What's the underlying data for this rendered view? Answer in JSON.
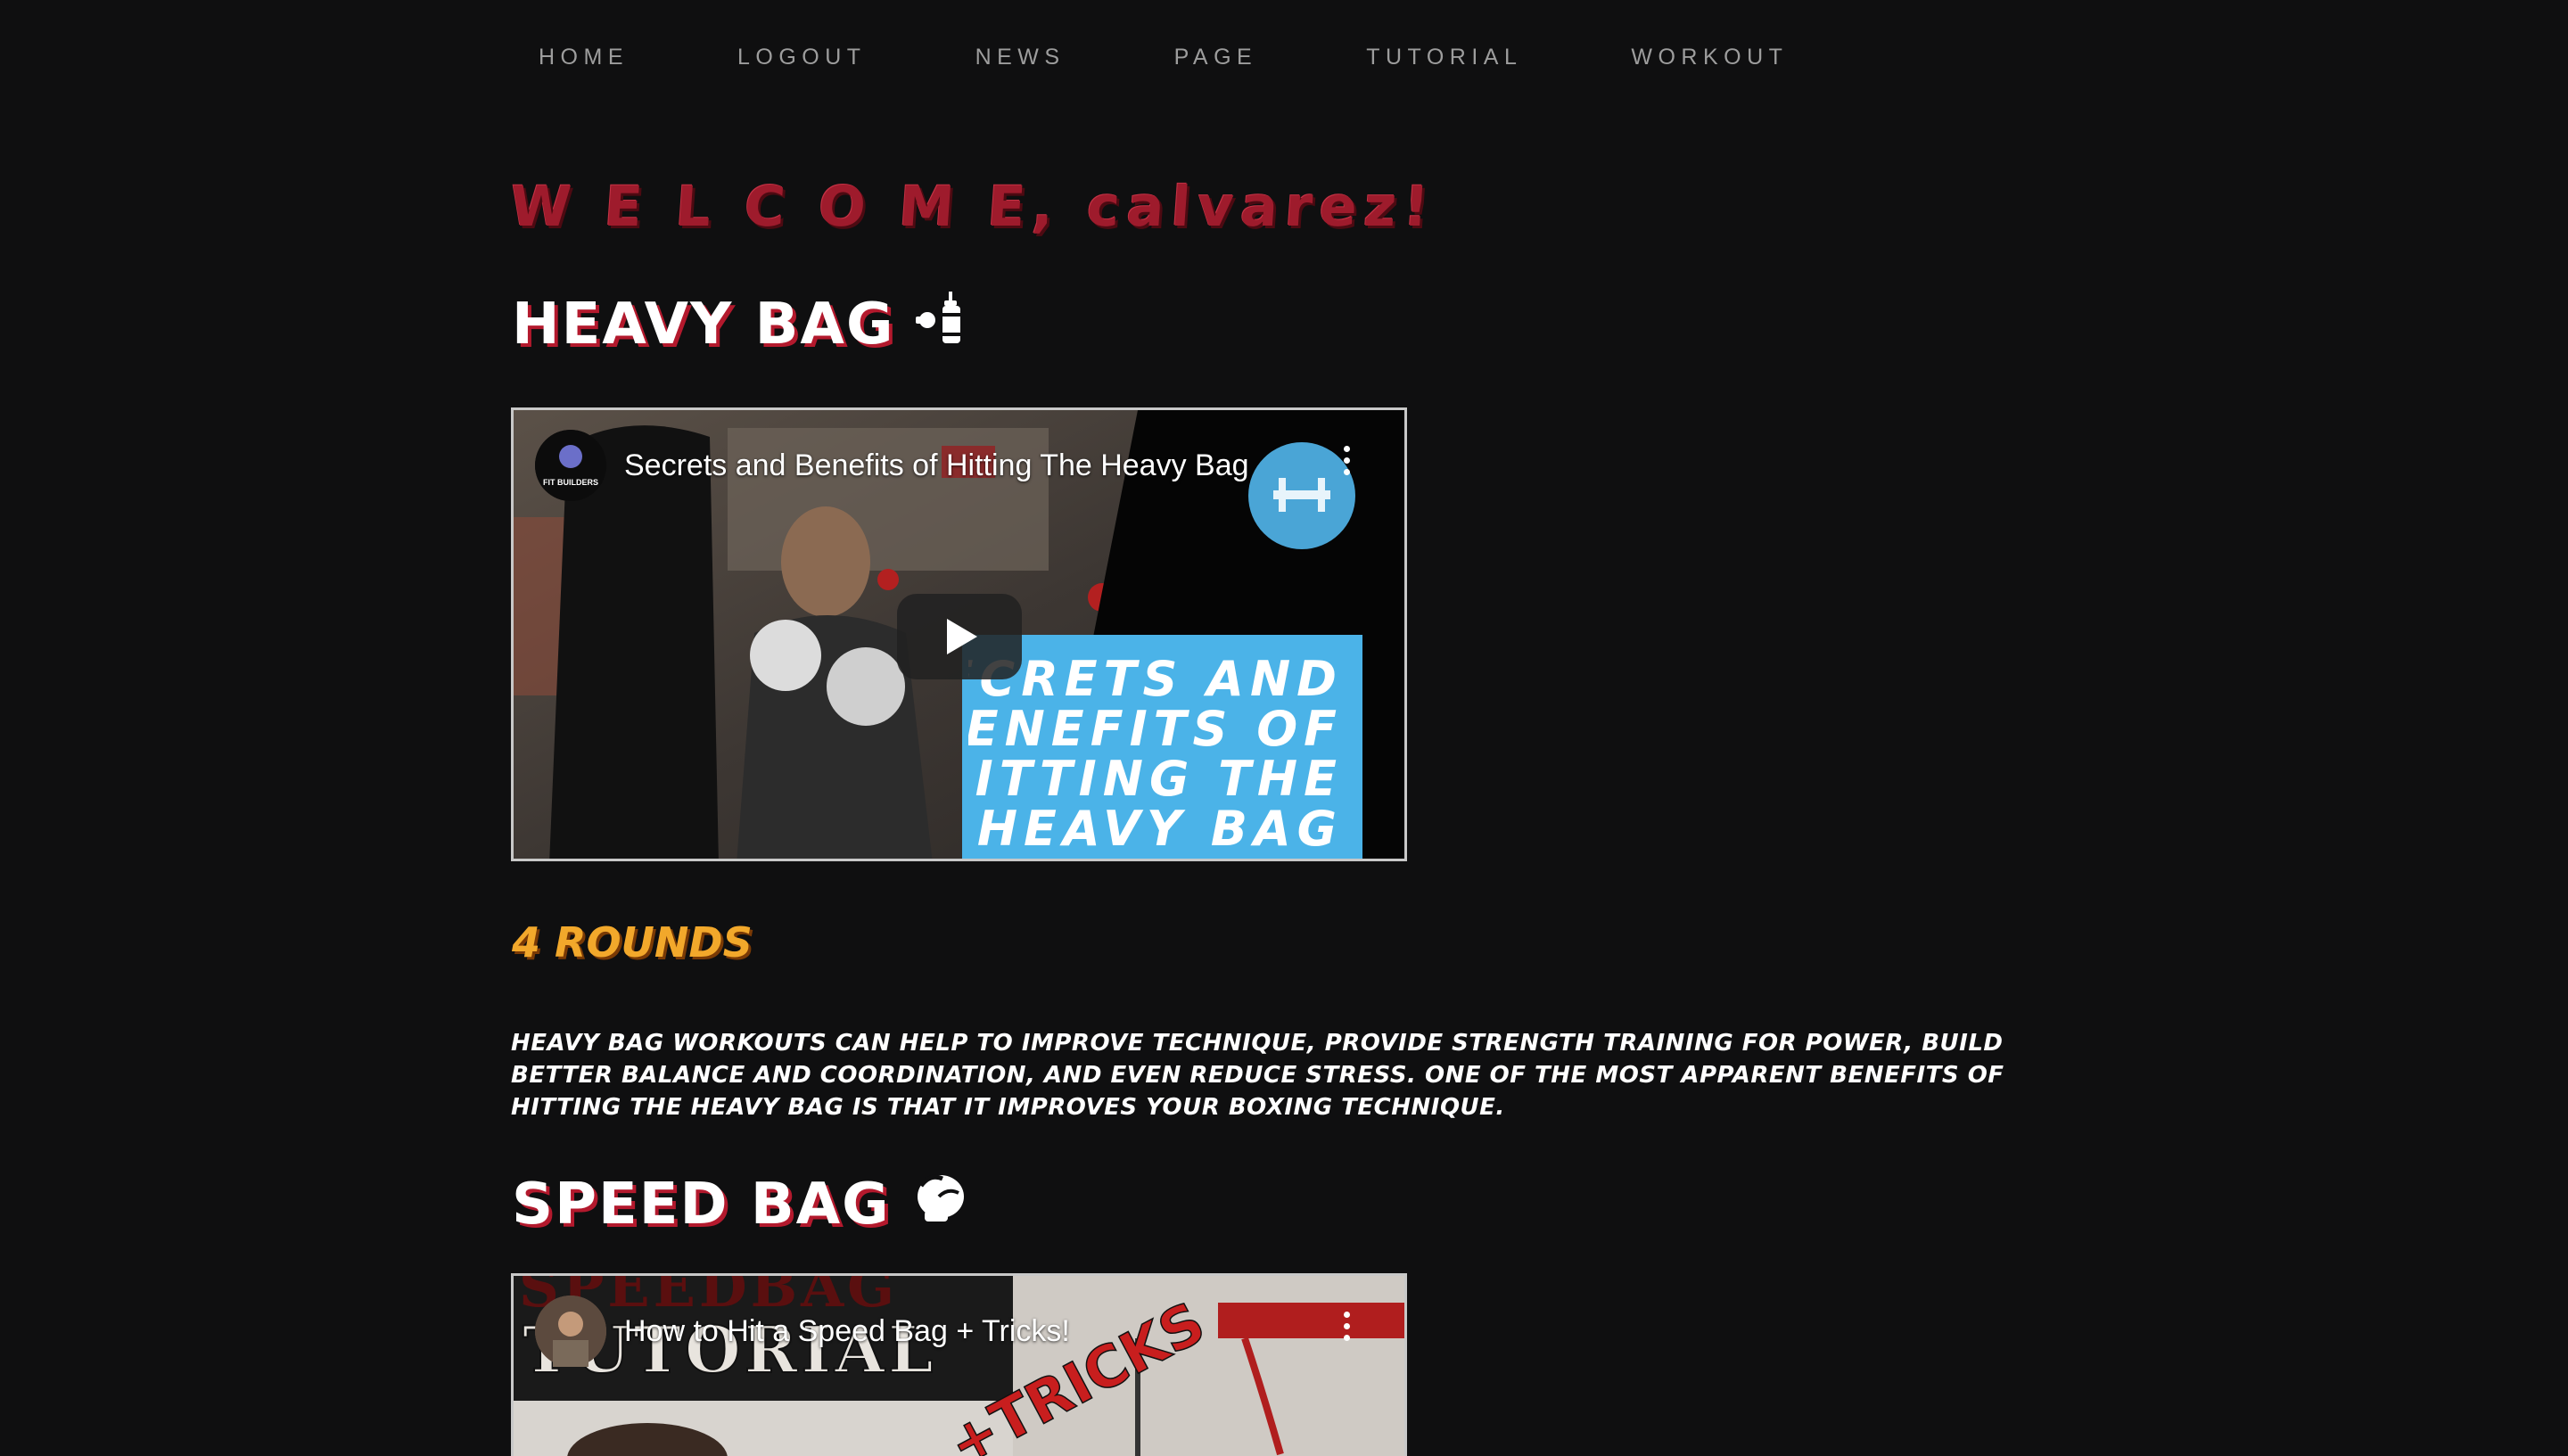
{
  "nav": {
    "items": [
      "HOME",
      "LOGOUT",
      "NEWS",
      "PAGE",
      "TUTORIAL",
      "WORKOUT"
    ]
  },
  "welcome": "W E L C O M E, calvarez!",
  "sections": [
    {
      "title": "Heavy Bag",
      "icon": "punching-bag-icon",
      "video": {
        "title": "Secrets and Benefits of Hitting The Heavy Bag",
        "channel_avatar_text": "FIT BUILDERS",
        "overlay_text": [
          "SECRETS AND",
          "BENEFITS OF",
          "HITTING THE",
          "HEAVY BAG"
        ]
      },
      "rounds": "4 ROUNDS",
      "description": "Heavy bag workouts can help to improve technique, provide strength training for power, build better balance and coordination, and even reduce stress. One of the most apparent benefits of hitting the heavy bag is that it improves your boxing technique."
    },
    {
      "title": "Speed Bag",
      "icon": "boxing-glove-icon",
      "video": {
        "title": "How to Hit a Speed Bag + Tricks!",
        "overlay_text": [
          "SPEEDBAG",
          "TUTORIAL",
          "+TRICKS"
        ]
      }
    }
  ],
  "colors": {
    "background": "#0f0f10",
    "nav_text": "#9d9d9d",
    "welcome": "#9e1b2c",
    "title_shadow": "#b3192d",
    "rounds": "#f2a82b",
    "video_overlay_blue": "#4bb3e8"
  }
}
